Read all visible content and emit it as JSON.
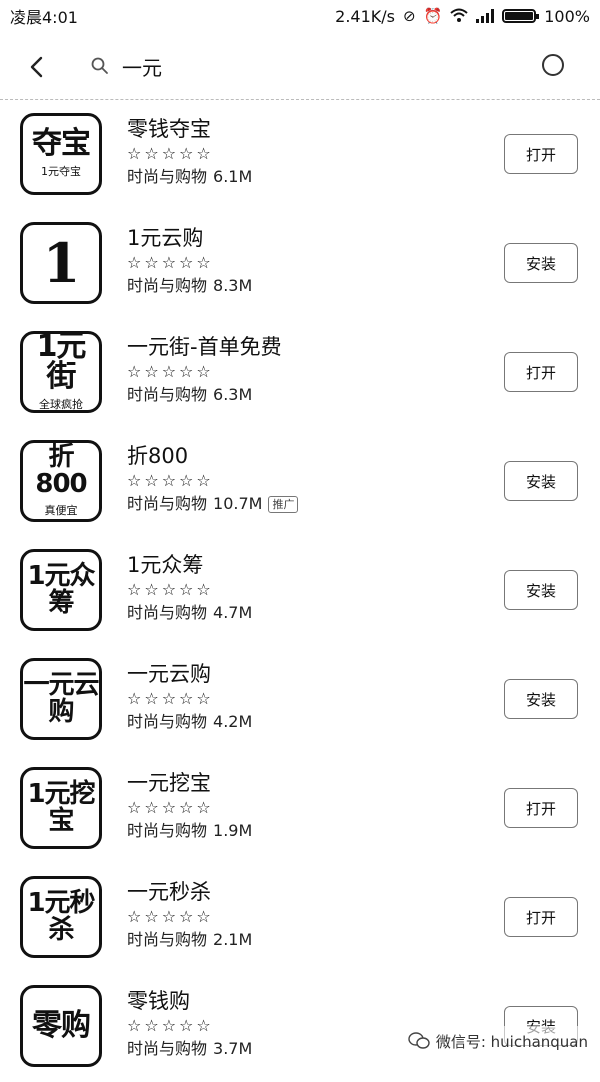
{
  "status_bar": {
    "time": "凌晨4:01",
    "net_speed": "2.41K/s",
    "battery": "100%",
    "battery_level": 1.0
  },
  "search": {
    "query": "一元",
    "back_icon": "chevron-left-icon",
    "search_icon": "search-icon",
    "voice_icon": "circle-icon"
  },
  "apps": [
    {
      "name": "零钱夺宝",
      "stars": "☆☆☆☆☆",
      "category": "时尚与购物",
      "size": "6.1M",
      "action": "打开",
      "icon_text": "夺宝",
      "icon_sub": "1元夺宝",
      "badge": ""
    },
    {
      "name": "1元云购",
      "stars": "☆☆☆☆☆",
      "category": "时尚与购物",
      "size": "8.3M",
      "action": "安装",
      "icon_text": "1",
      "icon_sub": "",
      "badge": ""
    },
    {
      "name": "一元街-首单免费",
      "stars": "☆☆☆☆☆",
      "category": "时尚与购物",
      "size": "6.3M",
      "action": "打开",
      "icon_text": "1元街",
      "icon_sub": "全球疯抢",
      "badge": ""
    },
    {
      "name": "折800",
      "stars": "☆☆☆☆☆",
      "category": "时尚与购物",
      "size": "10.7M",
      "action": "安装",
      "icon_text": "折800",
      "icon_sub": "真便宜",
      "badge": "推广"
    },
    {
      "name": "1元众筹",
      "stars": "☆☆☆☆☆",
      "category": "时尚与购物",
      "size": "4.7M",
      "action": "安装",
      "icon_text": "1元众筹",
      "icon_sub": "",
      "badge": ""
    },
    {
      "name": "一元云购",
      "stars": "☆☆☆☆☆",
      "category": "时尚与购物",
      "size": "4.2M",
      "action": "安装",
      "icon_text": "一元云购",
      "icon_sub": "",
      "badge": ""
    },
    {
      "name": "一元挖宝",
      "stars": "☆☆☆☆☆",
      "category": "时尚与购物",
      "size": "1.9M",
      "action": "打开",
      "icon_text": "1元挖宝",
      "icon_sub": "",
      "badge": ""
    },
    {
      "name": "一元秒杀",
      "stars": "☆☆☆☆☆",
      "category": "时尚与购物",
      "size": "2.1M",
      "action": "打开",
      "icon_text": "1元秒杀",
      "icon_sub": "",
      "badge": ""
    },
    {
      "name": "零钱购",
      "stars": "☆☆☆☆☆",
      "category": "时尚与购物",
      "size": "3.7M",
      "action": "安装",
      "icon_text": "零购",
      "icon_sub": "",
      "badge": ""
    }
  ],
  "watermark": {
    "text": "微信号: huichanquan",
    "icon": "wechat-icon"
  }
}
